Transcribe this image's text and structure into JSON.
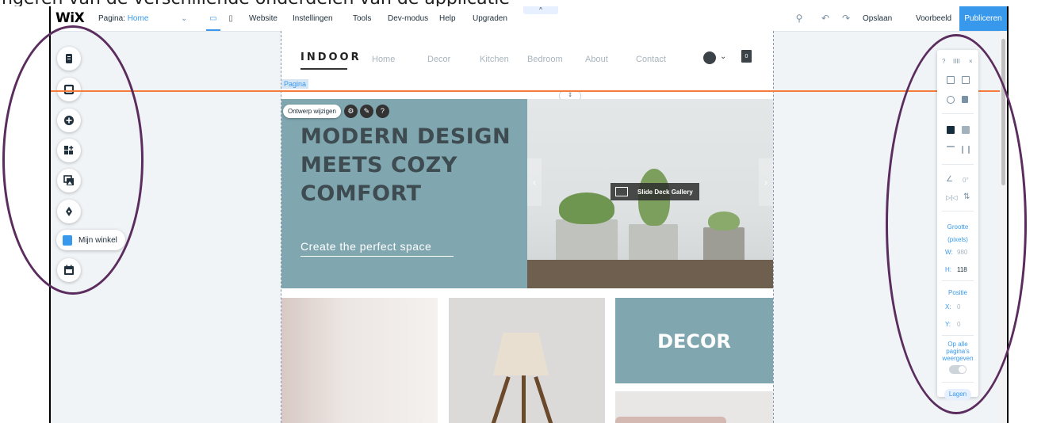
{
  "header_cut_text": "ngeren van de verschillende onderdelen van de applicatie",
  "topbar": {
    "logo": "WiX",
    "page_label": "Pagina:",
    "page_value": "Home",
    "menu": [
      "Website",
      "Instellingen",
      "Tools",
      "Dev-modus",
      "Help",
      "Upgraden"
    ],
    "handle": "^",
    "save": "Opslaan",
    "preview": "Voorbeeld",
    "publish": "Publiceren"
  },
  "left_toolbar": {
    "shop_label": "Mijn winkel"
  },
  "site": {
    "brand": "INDOOR",
    "nav": [
      "Home",
      "Decor",
      "Kitchen",
      "Bedroom",
      "About",
      "Contact"
    ],
    "cart_count": "0",
    "page_tag": "Pagina",
    "edit_design": "Ontwerp wijzigen",
    "hero_title": "MODERN DESIGN MEETS COZY COMFORT",
    "hero_subtitle": "Create the perfect space",
    "gallery_label": "Slide Deck Gallery",
    "decor_tile": "DECOR"
  },
  "right_panel": {
    "help": "?",
    "grid": "IIII",
    "close": "×",
    "rotation": "0°",
    "size_title": "Grootte",
    "size_unit": "(pixels)",
    "w_label": "W:",
    "w_value": "980",
    "h_label": "H:",
    "h_value": "118",
    "pos_title": "Positie",
    "x_label": "X:",
    "x_value": "0",
    "y_label": "Y:",
    "y_value": "0",
    "show_all_line1": "Op alle",
    "show_all_line2": "pagina's",
    "show_all_line3": "weergeven",
    "layers": "Lagen"
  },
  "colors": {
    "accent": "#3899ec",
    "highlight_oval": "#5b2c5e",
    "guide": "#f57c3a",
    "hero": "#80a7b0"
  }
}
